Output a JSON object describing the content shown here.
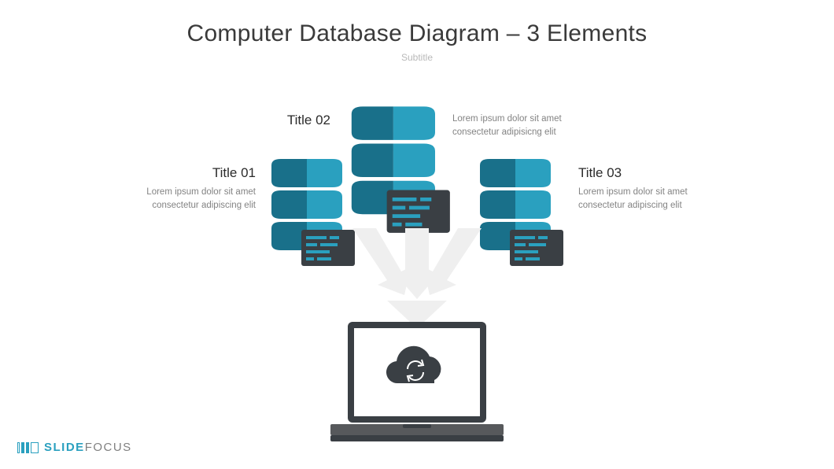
{
  "header": {
    "title": "Computer Database Diagram – 3 Elements",
    "subtitle": "Subtitle"
  },
  "elements": [
    {
      "label": "Title 01",
      "desc": "Lorem ipsum dolor sit amet consectetur adipiscing elit"
    },
    {
      "label": "Title 02",
      "desc": "Lorem ipsum dolor sit amet consectetur adipisicng elit"
    },
    {
      "label": "Title 03",
      "desc": "Lorem ipsum dolor sit amet consectetur adipiscing elit"
    }
  ],
  "colors": {
    "db_dark": "#19708a",
    "db_light": "#2aa0bf",
    "panel": "#3a3f44",
    "arrow": "#efefef",
    "laptop_body": "#3a3f44",
    "laptop_screen": "#ffffff",
    "cloud": "#3a3f44"
  },
  "brand": {
    "word1": "SLIDE",
    "word2": "FOCUS"
  }
}
